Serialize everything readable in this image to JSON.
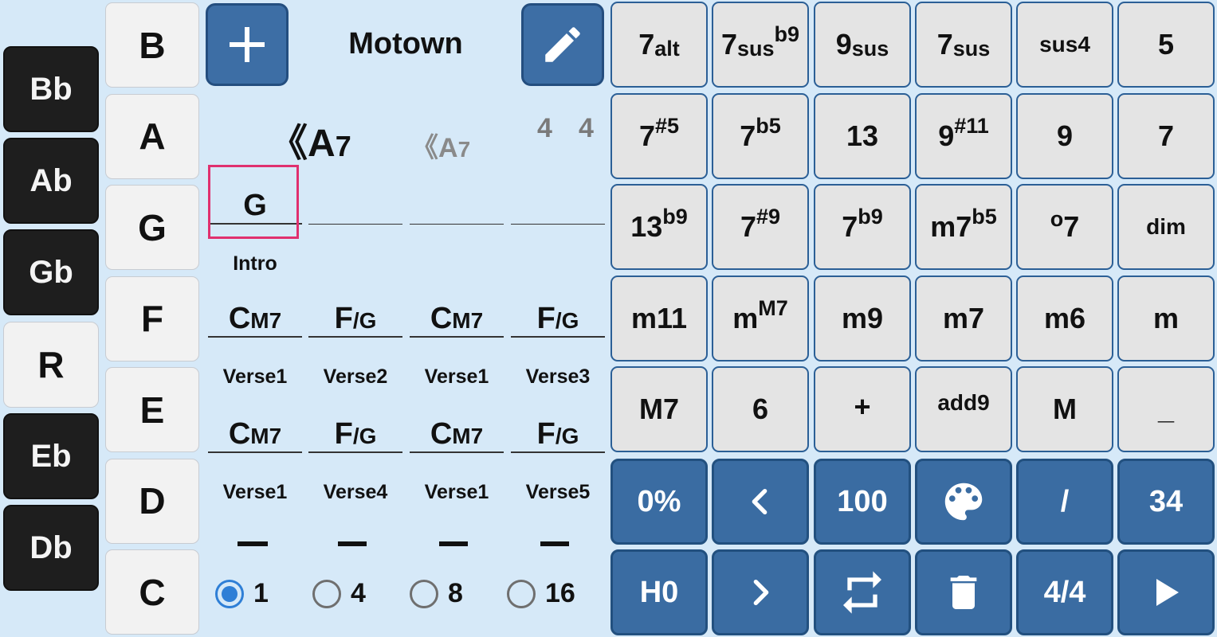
{
  "colors": {
    "background": "#d6e9f8",
    "accent": "#3d6ea5",
    "selection": "#e0306f"
  },
  "accidentals": [
    "Bb",
    "Ab",
    "Gb",
    "R",
    "Eb",
    "Db"
  ],
  "roots": [
    "B",
    "A",
    "G",
    "F",
    "E",
    "D",
    "C"
  ],
  "header": {
    "song_title": "Motown",
    "add_icon": "plus-icon",
    "edit_icon": "pencil-icon"
  },
  "current": {
    "chord_root": "A",
    "chord_quality": "7",
    "prev_root": "A",
    "prev_quality": "7",
    "time_top": "4",
    "time_bottom": "4"
  },
  "song": {
    "rows": [
      {
        "cells": [
          {
            "root": "G",
            "quality": ""
          },
          {
            "root": "",
            "quality": ""
          },
          {
            "root": "",
            "quality": ""
          },
          {
            "root": "",
            "quality": ""
          }
        ],
        "labels": [
          "Intro",
          "",
          "",
          ""
        ]
      },
      {
        "cells": [
          {
            "root": "C",
            "quality": "M7"
          },
          {
            "root": "F",
            "quality": "/G"
          },
          {
            "root": "C",
            "quality": "M7"
          },
          {
            "root": "F",
            "quality": "/G"
          }
        ],
        "labels": [
          "Verse1",
          "Verse2",
          "Verse1",
          "Verse3"
        ]
      },
      {
        "cells": [
          {
            "root": "C",
            "quality": "M7"
          },
          {
            "root": "F",
            "quality": "/G"
          },
          {
            "root": "C",
            "quality": "M7"
          },
          {
            "root": "F",
            "quality": "/G"
          }
        ],
        "labels": [
          "Verse1",
          "Verse4",
          "Verse1",
          "Verse5"
        ]
      }
    ]
  },
  "beats": {
    "options": [
      "1",
      "4",
      "8",
      "16"
    ],
    "selected": "1"
  },
  "qualities": [
    [
      {
        "main": "7",
        "sub": "alt"
      },
      {
        "main": "7",
        "sub": "sus",
        "sup": "b9"
      },
      {
        "main": "9",
        "sub": "sus"
      },
      {
        "main": "7",
        "sub": "sus"
      },
      {
        "main": "sus4",
        "small": true
      },
      {
        "main": "5"
      }
    ],
    [
      {
        "main": "7",
        "sup": "#5"
      },
      {
        "main": "7",
        "sup": "b5"
      },
      {
        "main": "13"
      },
      {
        "main": "9",
        "sup": "#11"
      },
      {
        "main": "9"
      },
      {
        "main": "7"
      }
    ],
    [
      {
        "main": "13",
        "sup": "b9"
      },
      {
        "main": "7",
        "sup": "#9"
      },
      {
        "main": "7",
        "sup": "b9"
      },
      {
        "main": "m7",
        "sup": "b5"
      },
      {
        "main": "7",
        "pre": "o"
      },
      {
        "main": "dim",
        "small": true
      }
    ],
    [
      {
        "main": "m11"
      },
      {
        "main": "m",
        "sup": "M7"
      },
      {
        "main": "m9"
      },
      {
        "main": "m7"
      },
      {
        "main": "m6"
      },
      {
        "main": "m"
      }
    ],
    [
      {
        "main": "M7"
      },
      {
        "main": "6"
      },
      {
        "main": "+",
        "raise": true
      },
      {
        "main": "add9",
        "small": true,
        "raise": true
      },
      {
        "main": "M"
      },
      {
        "main": "_"
      }
    ]
  ],
  "controls_row1": [
    {
      "name": "percent-button",
      "label": "0%"
    },
    {
      "name": "previous-button",
      "icon": "chevron-left-icon"
    },
    {
      "name": "tempo-button",
      "label": "100"
    },
    {
      "name": "palette-button",
      "icon": "palette-icon"
    },
    {
      "name": "slash-button",
      "label": "/"
    },
    {
      "name": "count-button",
      "label": "34"
    }
  ],
  "controls_row2": [
    {
      "name": "hold-button",
      "label": "H0"
    },
    {
      "name": "next-button",
      "icon": "chevron-right-icon"
    },
    {
      "name": "repeat-button",
      "icon": "repeat-icon"
    },
    {
      "name": "delete-button",
      "icon": "trash-icon"
    },
    {
      "name": "time-signature-button",
      "label": "4/4"
    },
    {
      "name": "play-button",
      "icon": "play-icon"
    }
  ]
}
